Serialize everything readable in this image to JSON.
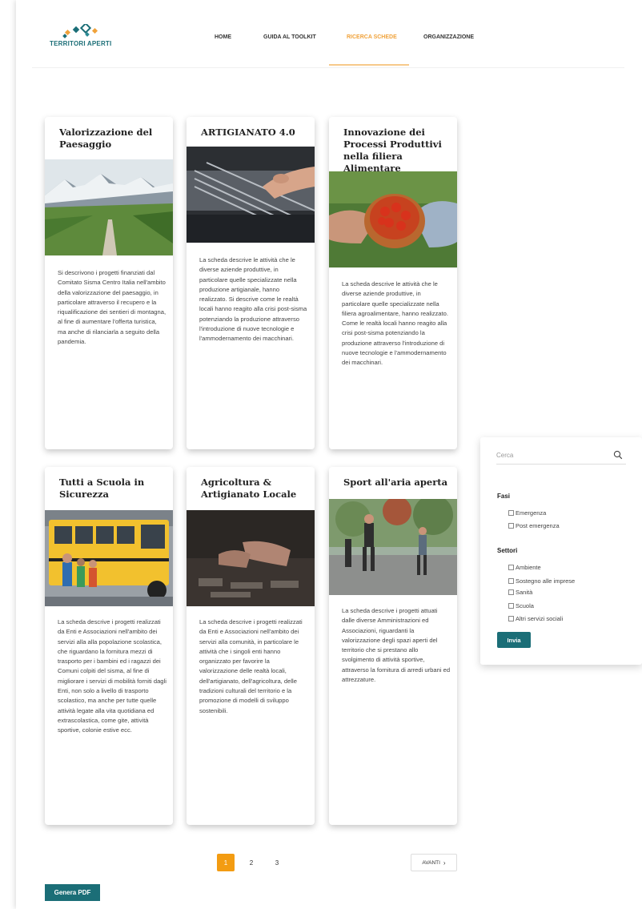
{
  "brand": {
    "logo_text": "TERRITORI APERTI",
    "primary_color": "#1b6e77",
    "accent_color": "#f39c12"
  },
  "nav": {
    "items": [
      {
        "label": "HOME",
        "active": false
      },
      {
        "label": "GUIDA AL TOOLKIT",
        "active": false
      },
      {
        "label": "RICERCA SCHEDE",
        "active": true
      },
      {
        "label": "ORGANIZZAZIONE",
        "active": false
      }
    ]
  },
  "cards": [
    {
      "title": "Valorizzazione del Paesaggio",
      "image": "mountain-landscape-image",
      "description": "Si descrivono i progetti finanziati dal Comitato Sisma Centro Italia nell'ambito della valorizzazione del paesaggio, in particolare attraverso il recupero e la riqualificazione dei sentieri di montagna, al fine di aumentare l'offerta turistica, ma anche di rilanciarla a seguito della pandemia."
    },
    {
      "title": "ARTIGIANATO 4.0",
      "image": "machinery-image",
      "description": "La scheda descrive le attività che le diverse aziende produttive, in particolare quelle specializzate nella produzione artigianale, hanno realizzato. Si descrive come le realtà locali hanno reagito alla crisi post-sisma potenziando la produzione attraverso l'introduzione di nuove tecnologie e l'ammodernamento dei macchinari."
    },
    {
      "title": "Innovazione dei Processi Produttivi nella filiera Alimentare",
      "image": "tomatoes-bowl-image",
      "description": "La scheda descrive le attività che le diverse aziende produttive, in particolare quelle specializzate nella filiera agroalimentare, hanno realizzato. Come le realtà locali hanno reagito alla crisi post-sisma potenziando la produzione attraverso l'introduzione di nuove tecnologie e l'ammodernamento dei macchinari."
    },
    {
      "title": "Tutti a Scuola in Sicurezza",
      "image": "school-bus-image",
      "description": "La scheda descrive i progetti realizzati da Enti e Associazioni nell'ambito dei servizi alla alla popolazione scolastica, che riguardano la fornitura mezzi di trasporto per i bambini ed i ragazzi dei Comuni colpiti del sisma, al fine di migliorare i servizi di mobilità forniti dagli Enti, non solo a livello di trasporto scolastico, ma anche per tutte quelle attività legate alla vita quotidiana ed extrascolastica, come gite, attività sportive, colonie estive ecc."
    },
    {
      "title": "Agricoltura & Artigianato Locale",
      "image": "craftsman-hands-image",
      "description": "La scheda descrive i progetti realizzati da Enti e Associazioni nell'ambito dei servizi alla comunità, in particolare le attività che i singoli enti hanno organizzato per favorire la valorizzazione delle realtà locali, dell'artigianato, dell'agricoltura, delle tradizioni culturali del territorio e la promozione di modelli di sviluppo sostenibili."
    },
    {
      "title": "Sport all'aria aperta",
      "image": "outdoor-runners-image",
      "description": "La scheda descrive i progetti attuati dalle diverse Amministrazioni ed Associazioni, riguardanti la valorizzazione degli spazi aperti del territorio che si prestano allo svolgimento di attività sportive, attraverso la fornitura di arredi urbani ed attrezzature."
    }
  ],
  "filter": {
    "search_placeholder": "Cerca",
    "fasi_heading": "Fasi",
    "fasi": [
      "Emergenza",
      "Post emergenza"
    ],
    "settori_heading": "Settori",
    "settori": [
      "Ambiente",
      "Sostegno alle imprese",
      "Sanità",
      "Scuola",
      "Altri servizi sociali"
    ],
    "submit_label": "Invia"
  },
  "pagination": {
    "pages": [
      "1",
      "2",
      "3"
    ],
    "current": "1",
    "next_label": "AVANTI"
  },
  "pdf_button_label": "Genera PDF"
}
